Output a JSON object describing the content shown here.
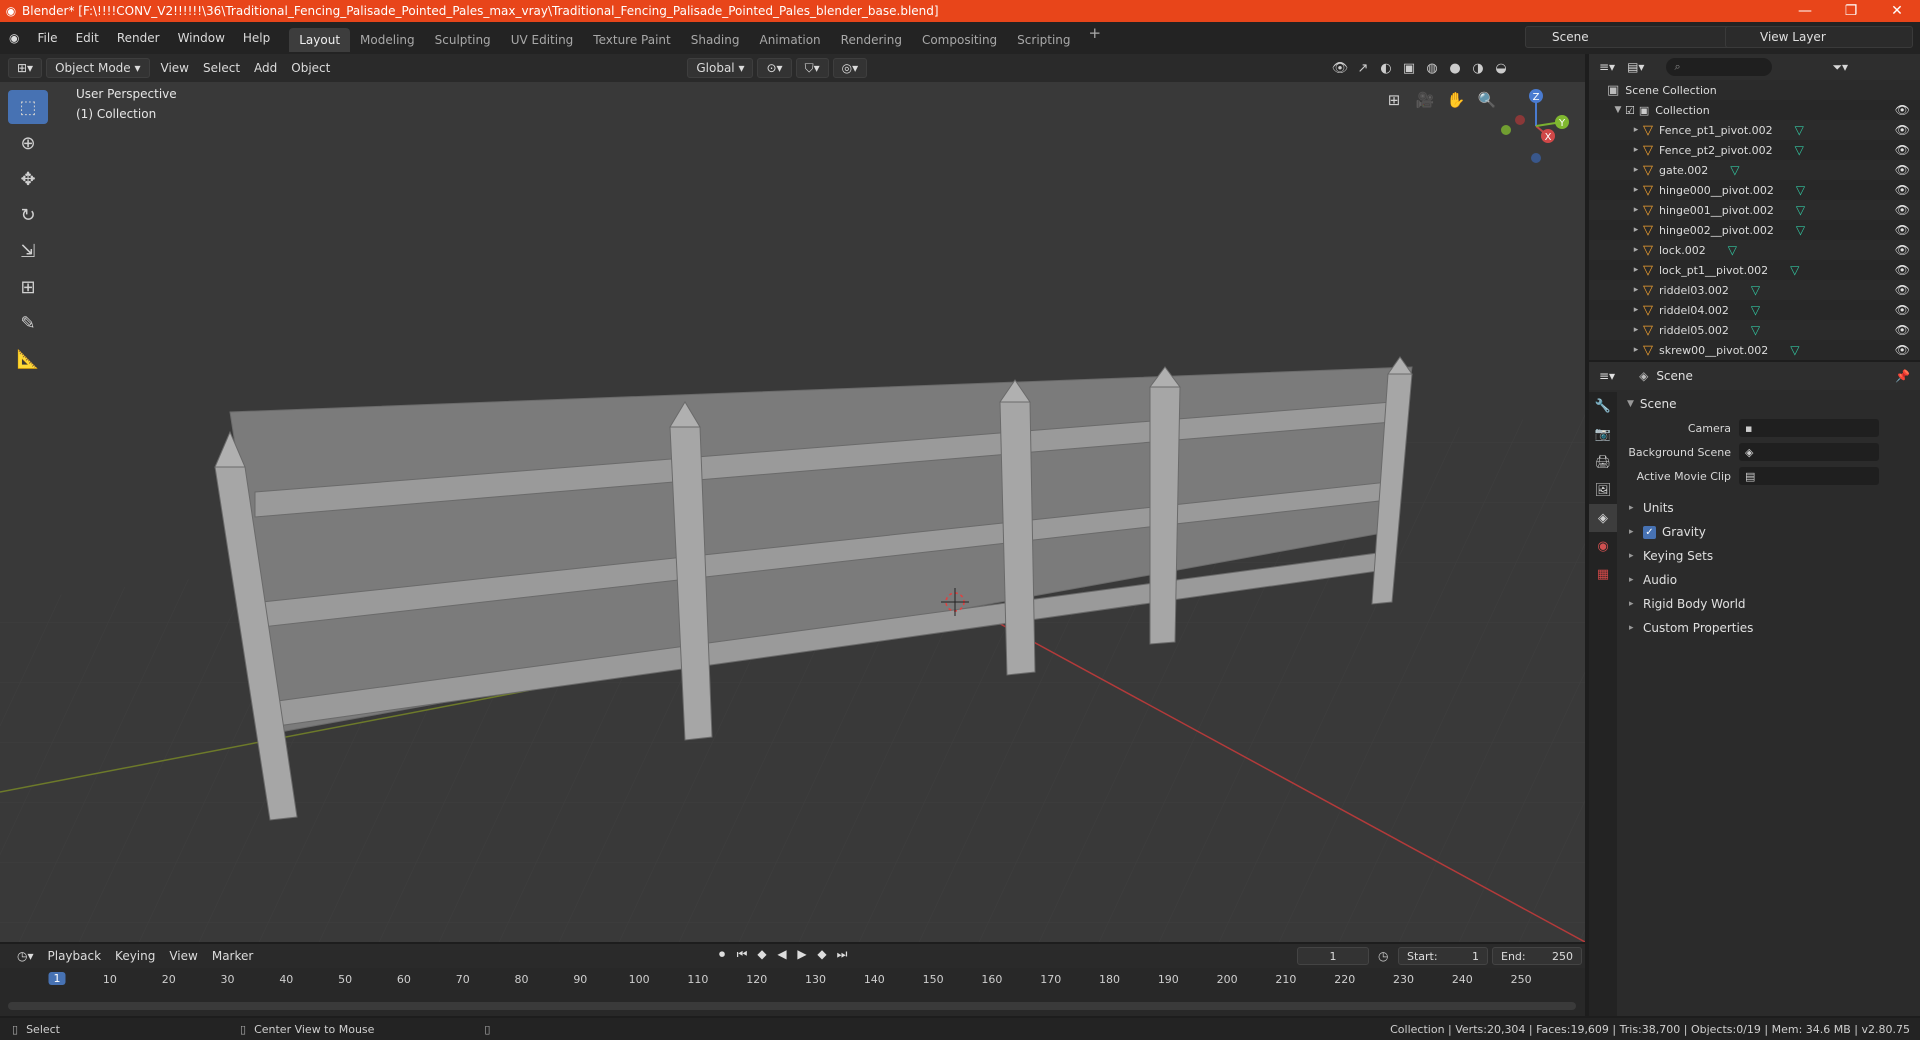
{
  "window": {
    "title": "Blender* [F:\\!!!!CONV_V2!!!!!!\\36\\Traditional_Fencing_Palisade_Pointed_Pales_max_vray\\Traditional_Fencing_Palisade_Pointed_Pales_blender_base.blend]",
    "controls": [
      "—",
      "❐",
      "✕"
    ]
  },
  "menu": [
    "File",
    "Edit",
    "Render",
    "Window",
    "Help"
  ],
  "workspaces": [
    "Layout",
    "Modeling",
    "Sculpting",
    "UV Editing",
    "Texture Paint",
    "Shading",
    "Animation",
    "Rendering",
    "Compositing",
    "Scripting"
  ],
  "active_workspace": "Layout",
  "scene_selector": "Scene",
  "view_layer": "View Layer",
  "viewport_header": {
    "mode": "Object Mode",
    "menus": [
      "View",
      "Select",
      "Add",
      "Object"
    ],
    "transform_orientation": "Global"
  },
  "viewport": {
    "perspective": "User Perspective",
    "collection": "(1) Collection"
  },
  "gizmo_axes": [
    "Z",
    "X",
    "Y"
  ],
  "outliner": {
    "search_placeholder": "",
    "root": "Scene Collection",
    "collection": "Collection",
    "items": [
      "Fence_pt1_pivot.002",
      "Fence_pt2_pivot.002",
      "gate.002",
      "hinge000__pivot.002",
      "hinge001__pivot.002",
      "hinge002__pivot.002",
      "lock.002",
      "lock_pt1__pivot.002",
      "riddel03.002",
      "riddel04.002",
      "riddel05.002",
      "skrew00__pivot.002"
    ]
  },
  "properties": {
    "header": "Scene",
    "panel": "Scene",
    "fields": {
      "camera_label": "Camera",
      "background_label": "Background Scene",
      "movieclip_label": "Active Movie Clip"
    },
    "subpanels": [
      "Units",
      "Gravity",
      "Keying Sets",
      "Audio",
      "Rigid Body World",
      "Custom Properties"
    ],
    "gravity_checked": true
  },
  "timeline": {
    "menus": [
      "Playback",
      "Keying",
      "View",
      "Marker"
    ],
    "current_frame": "1",
    "start_label": "Start:",
    "start": "1",
    "end_label": "End:",
    "end": "250",
    "ticks": [
      "10",
      "20",
      "30",
      "40",
      "50",
      "60",
      "70",
      "80",
      "90",
      "100",
      "110",
      "120",
      "130",
      "140",
      "150",
      "160",
      "170",
      "180",
      "190",
      "200",
      "210",
      "220",
      "230",
      "240",
      "250"
    ]
  },
  "status": {
    "left": "Select",
    "middle": "Center View to Mouse",
    "right": "Collection | Verts:20,304 | Faces:19,609 | Tris:38,700 | Objects:0/19 | Mem: 34.6 MB | v2.80.75"
  },
  "colors": {
    "accent": "#4772b3",
    "titlebar": "#e8451a",
    "mesh_icon": "#f0a030",
    "data_icon": "#32c6a0"
  }
}
